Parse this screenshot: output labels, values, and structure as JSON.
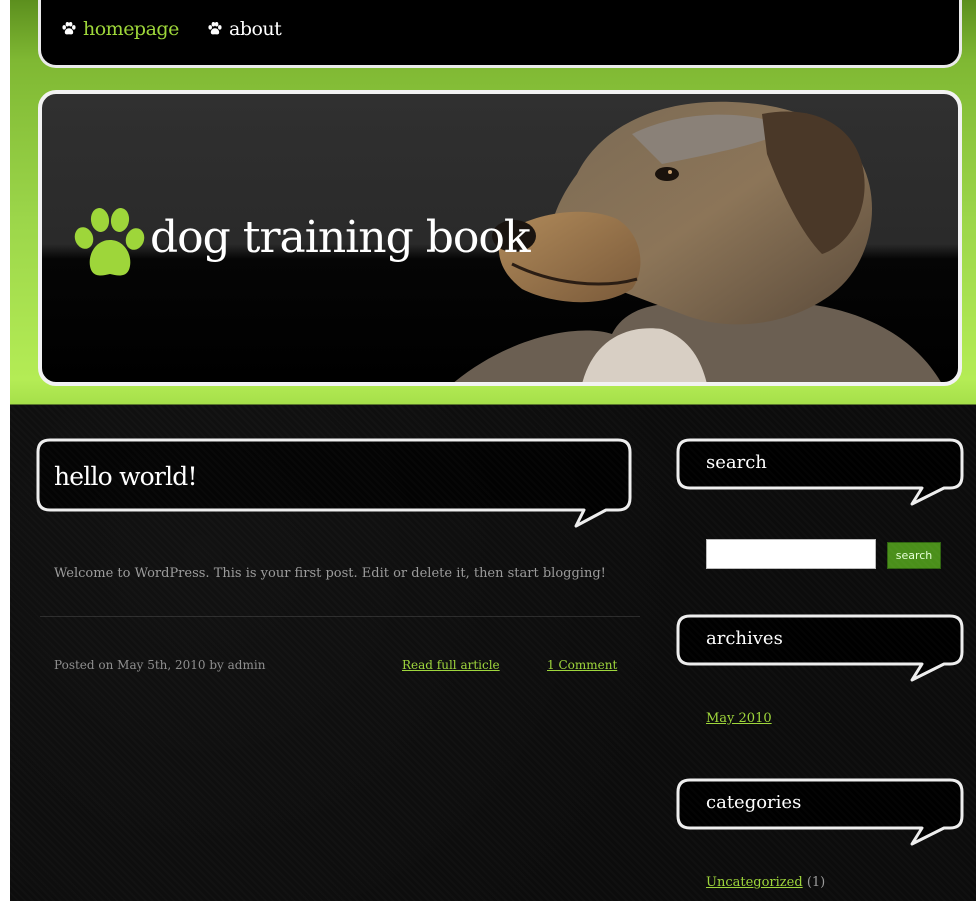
{
  "nav": {
    "items": [
      {
        "label": "homepage",
        "active": true
      },
      {
        "label": "about",
        "active": false
      }
    ]
  },
  "header": {
    "site_title": "dog training book",
    "logo_icon": "paw-icon",
    "image": "dog-portrait"
  },
  "post": {
    "title": "hello world!",
    "excerpt": "Welcome to WordPress. This is your first post. Edit or delete it, then start blogging!",
    "meta": "Posted on May 5th, 2010 by admin",
    "read_more_label": "Read full article",
    "comments_label": "1 Comment"
  },
  "sidebar": {
    "search": {
      "heading": "search",
      "input_value": "",
      "button_label": "search"
    },
    "archives": {
      "heading": "archives",
      "items": [
        {
          "label": "May 2010"
        }
      ]
    },
    "categories": {
      "heading": "categories",
      "items": [
        {
          "label": "Uncategorized",
          "count": "(1)"
        }
      ]
    }
  },
  "colors": {
    "accent_green": "#9ed63a",
    "button_green": "#4a8f1a",
    "background": "#0c0c0c"
  }
}
